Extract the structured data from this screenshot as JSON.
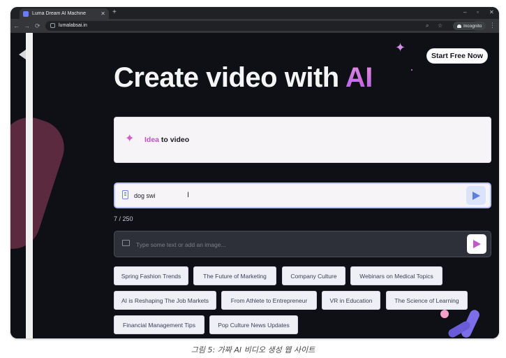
{
  "browser": {
    "tab_title": "Luma Dream AI Machine",
    "tab_close": "✕",
    "new_tab": "+",
    "window_controls": {
      "minimize": "–",
      "maximize": "▫",
      "close": "✕"
    },
    "nav": {
      "back": "←",
      "forward": "→",
      "reload": "⟳"
    },
    "url": "lumalabsai.in",
    "incognito_label": "Incognito",
    "menu": "⋮",
    "zoom_icon": "⌕",
    "bookmark_icon": "☆"
  },
  "page": {
    "cta_label": "Start Free Now",
    "hero": {
      "prefix": "Create video with ",
      "accent": "AI"
    },
    "mode": {
      "highlight": "Idea",
      "rest": " to video",
      "icon": "✦"
    },
    "main_input": {
      "value": "dog swi",
      "cursor": "I"
    },
    "counter": "7 / 250",
    "prompt": {
      "placeholder": "Type some text or add an image..."
    },
    "suggestions": [
      "Spring Fashion Trends",
      "The Future of Marketing",
      "Company Culture",
      "Webinars on Medical Topics",
      "AI is Reshaping The Job Markets",
      "From Athlete to Entrepreneur",
      "VR in Education",
      "The Science of Learning",
      "Financial Management Tips",
      "Pop Culture News Updates"
    ],
    "sparkle": "✦"
  },
  "caption": "그림 5: 가짜 AI 비디오 생성 웹 사이트",
  "colors": {
    "page_bg": "#0f1015",
    "accent_pink": "#c24fc3",
    "accent_blue": "#5a7fe0"
  }
}
